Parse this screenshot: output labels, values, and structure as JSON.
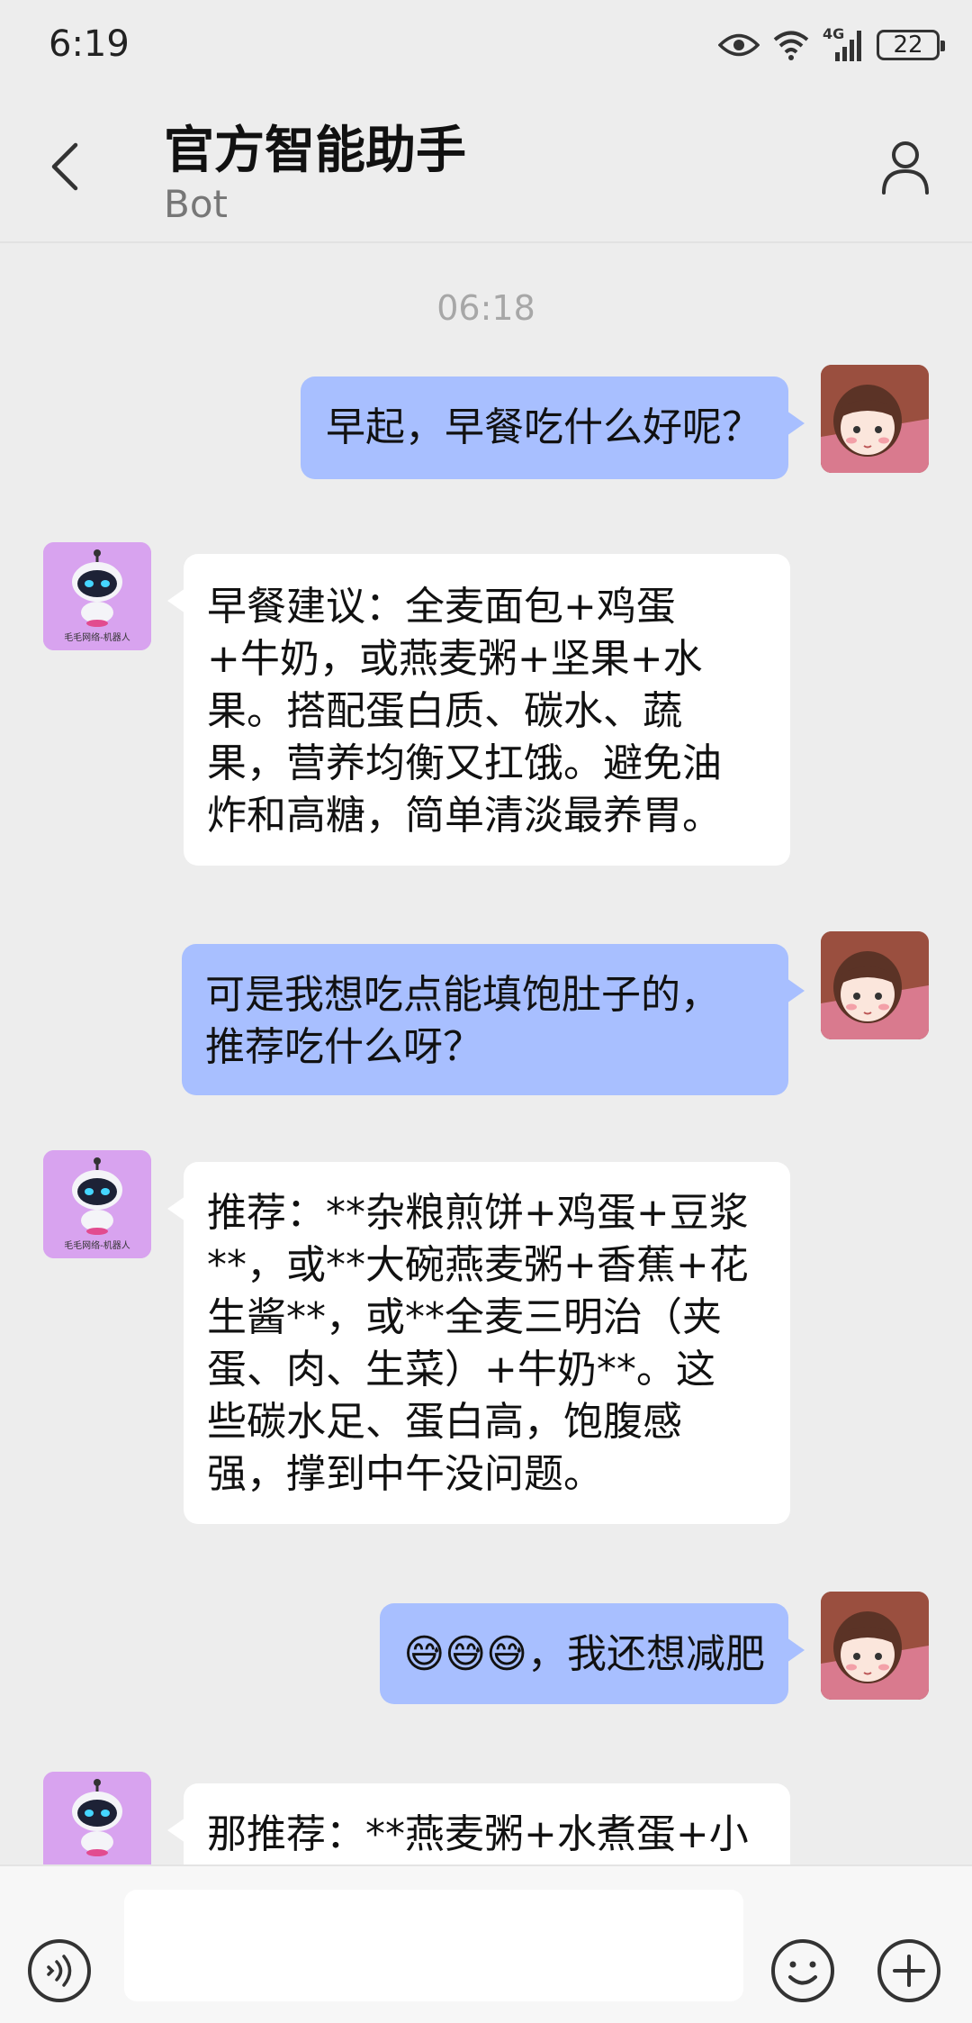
{
  "status_bar": {
    "time": "6:19",
    "network": "4G",
    "battery": "22",
    "icons": [
      "eye-icon",
      "wifi-icon",
      "signal-icon",
      "battery-icon"
    ]
  },
  "header": {
    "title": "官方智能助手",
    "subtitle": "Bot",
    "back_icon": "chevron-left-icon",
    "profile_icon": "person-icon"
  },
  "chat": {
    "timestamp": "06:18",
    "messages": [
      {
        "sender": "user",
        "text": "早起，早餐吃什么好呢？"
      },
      {
        "sender": "bot",
        "text": "早餐建议：全麦面包+鸡蛋\n+牛奶，或燕麦粥+坚果+水\n果。搭配蛋白质、碳水、蔬\n果，营养均衡又扛饿。避免油\n炸和高糖，简单清淡最养胃。"
      },
      {
        "sender": "user",
        "text": "可是我想吃点能填饱肚子的，\n推荐吃什么呀？"
      },
      {
        "sender": "bot",
        "text": "推荐：**杂粮煎饼+鸡蛋+豆浆\n**，或**大碗燕麦粥+香蕉+花\n生酱**，或**全麦三明治（夹\n蛋、肉、生菜）+牛奶**。这\n些碳水足、蛋白高，饱腹感\n强，撑到中午没问题。"
      },
      {
        "sender": "user",
        "text": "😅😅😅，我还想减肥"
      },
      {
        "sender": "bot",
        "text": "那推荐：**燕麦粥+水煮蛋+小"
      }
    ],
    "bot_avatar_label": "毛毛网络-机器人"
  },
  "input_bar": {
    "value": "",
    "voice_icon": "voice-icon",
    "emoji_icon": "emoji-icon",
    "plus_icon": "plus-icon"
  },
  "colors": {
    "background": "#ededed",
    "user_bubble": "#a8bfff",
    "bot_bubble": "#ffffff",
    "bot_avatar_bg": "#d8a3ef"
  }
}
